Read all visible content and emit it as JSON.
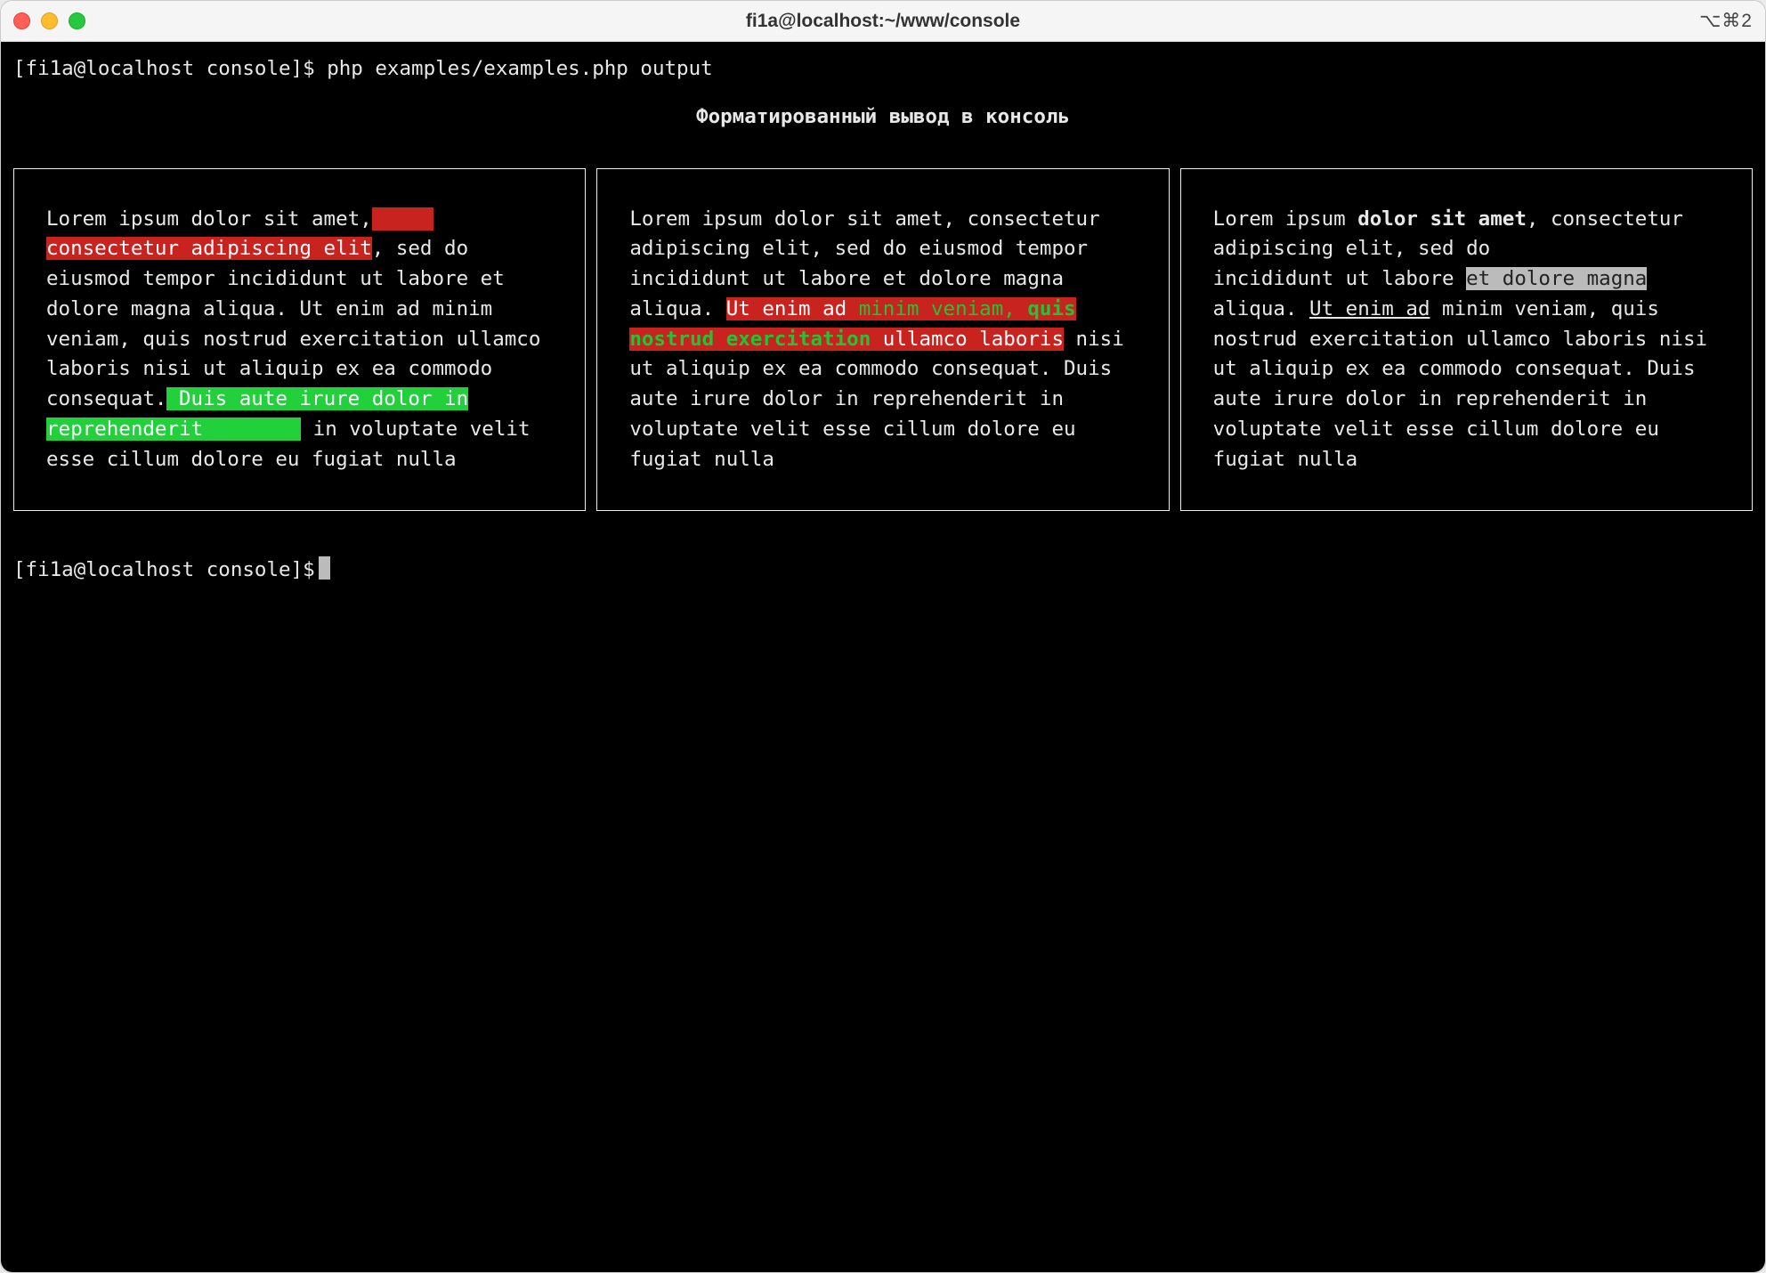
{
  "window": {
    "title": "fi1a@localhost:~/www/console",
    "right_shortcut": "⌥⌘2"
  },
  "terminal": {
    "prompt1_prefix": "[fi1a@localhost console]$ ",
    "prompt1_cmd": "php examples/examples.php output",
    "heading": "Форматированный вывод в консоль",
    "panel1": {
      "t0": "Lorem ipsum dolor sit amet,",
      "t1": " consectetur adipiscing elit",
      "t2": ", sed do eiusmod tempor incididunt ut labore et dolore magna aliqua. Ut enim ad minim veniam, quis nostrud exercitation ullamco laboris nisi ut aliquip ex ea commodo consequat.",
      "t3": " Duis aute irure dolor in reprehenderit",
      "t4": " in voluptate velit esse cillum dolore eu fugiat nulla"
    },
    "panel2": {
      "t0": "Lorem ipsum dolor sit amet, consectetur adipiscing elit, sed do eiusmod tempor incididunt ut labore et dolore magna aliqua. ",
      "t1a": "Ut enim ad ",
      "t1b": "minim veniam, ",
      "t1c": "quis nostrud exercitation",
      "t1d": " ullamco laboris",
      "t2": " nisi ut aliquip ex ea commodo consequat. Duis aute irure dolor in reprehenderit in voluptate velit esse cillum dolore eu fugiat nulla"
    },
    "panel3": {
      "t0": "Lorem ipsum ",
      "tbold": "dolor sit amet",
      "t1": ", consectetur adipiscing elit, sed do",
      "t2": "incididunt ut labore ",
      "tgrey1": "et dolore magna",
      "t3": " aliqua. ",
      "tund": "Ut enim ad",
      "t4": " minim veniam, quis nostrud exercitation ullamco laboris nisi ut aliquip ex ea commodo consequat. Duis aute irure dolor in reprehenderit in voluptate velit esse cillum dolore eu fugiat nulla"
    },
    "prompt2_prefix": "[fi1a@localhost console]$"
  }
}
